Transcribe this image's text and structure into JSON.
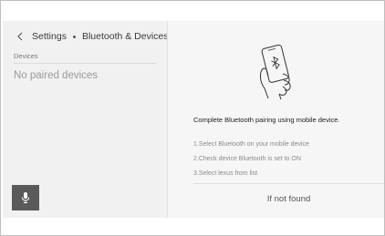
{
  "header": {
    "back_icon": "chevron-left-icon",
    "breadcrumb": [
      "Settings",
      "Bluetooth & Devices"
    ]
  },
  "devices": {
    "section_label": "Devices",
    "empty_message": "No paired devices"
  },
  "voice": {
    "icon": "microphone-icon"
  },
  "pairing": {
    "illustration_icon": "phone-bluetooth-icon",
    "instruction": "Complete Bluetooth pairing using mobile device.",
    "steps": [
      "1.Select Bluetooth on your mobile device",
      "2.Check device Bluetooth is set to ON",
      "3.Select lexus from list"
    ],
    "not_found_label": "If not found"
  },
  "colors": {
    "background": "#f3f3f3",
    "mic_button": "#5a5a5a",
    "muted_text": "#9a9a9a"
  }
}
